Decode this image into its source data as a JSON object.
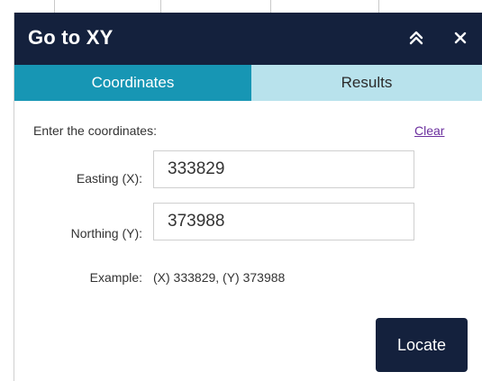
{
  "header": {
    "title": "Go to XY",
    "collapse_icon": "double-chevron-up-icon",
    "close_icon": "close-icon"
  },
  "tabs": [
    {
      "label": "Coordinates",
      "active": true
    },
    {
      "label": "Results",
      "active": false
    }
  ],
  "form": {
    "instruction": "Enter the coordinates:",
    "clear_label": "Clear",
    "easting_label": "Easting (X):",
    "easting_value": "333829",
    "northing_label": "Northing (Y):",
    "northing_value": "373988",
    "example_label": "Example:",
    "example_value": "(X) 333829, (Y) 373988",
    "locate_label": "Locate"
  },
  "colors": {
    "header_bg": "#14213d",
    "active_tab_bg": "#1796b4",
    "inactive_tab_bg": "#b8e2ec",
    "link": "#6b2f9e"
  }
}
